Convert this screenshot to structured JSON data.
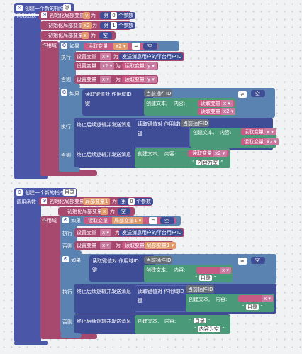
{
  "block1": {
    "header_label": "创建一个新的指令",
    "header_value": "渗",
    "call_label": "调用函数",
    "inits": [
      {
        "label": "初始化局部变量",
        "var": "y",
        "as": "为",
        "pre": "第",
        "index": "0",
        "post": "个参数"
      },
      {
        "label": "初始化局部变量",
        "var": "x2",
        "as": "为",
        "pre": "第",
        "index": "1",
        "post": "个参数"
      },
      {
        "label": "初始化局部变量",
        "var": "x",
        "as": "为",
        "value": "空"
      }
    ],
    "scope_label": "作用域",
    "if1": {
      "if_label": "如果",
      "cond_get": "读取变量",
      "cond_var": "x2",
      "cond_op": "=",
      "cond_value": "空",
      "then_label": "执行",
      "then_set": "设置变量",
      "then_var": "x",
      "then_as": "为",
      "then_value": "发送消息用户的平台用户ID",
      "then_set2": "设置变量",
      "then_var2": "x2",
      "then_as2": "为",
      "then_get2": "读取变量",
      "then_get_var2": "y",
      "else_label": "否则",
      "else_set": "设置变量",
      "else_var": "x",
      "else_as": "为",
      "else_get": "读取变量",
      "else_get_var": "y"
    },
    "if2": {
      "if_label": "如果",
      "kv_label": "读取键值对 作用域ID",
      "key_label": "键",
      "bot_id": "当前插件ID",
      "create_text": "创建文本,",
      "content_label": "内容:",
      "get_label": "读取变量",
      "get_x": "x",
      "get_x2": "x2",
      "op": "≠",
      "null_value": "空",
      "then_label": "执行",
      "stop_label": "终止后续逻辑并发送消息",
      "kv_label2": "读取键值对 作用域ID",
      "key_label2": "键",
      "bot_id2": "当前插件ID",
      "create_text2": "创建文本,",
      "content_label2": "内容:",
      "get_x_2": "x",
      "get_x2_2": "x2",
      "else_label": "否则",
      "else_stop": "终止后续逻辑并发送消息",
      "else_create": "创建文本,",
      "else_content": "内容:",
      "else_get_var": "x2",
      "else_string": "内容为空"
    }
  },
  "block2": {
    "header_label": "创建一个新的指令",
    "header_value": "目录",
    "call_label": "调用函数",
    "inits": [
      {
        "label": "初始化局部变量",
        "var": "局部变量1",
        "as": "为",
        "pre": "第",
        "index": "0",
        "post": "个参数"
      },
      {
        "label": "初始化局部变量",
        "var": "x",
        "as": "为",
        "value": "空"
      }
    ],
    "scope_label": "作用域",
    "if1": {
      "if_label": "如果",
      "cond_get": "读取变量",
      "cond_var": "局部变量1",
      "cond_op": "=",
      "cond_value": "空",
      "then_label": "执行",
      "then_set": "设置变量",
      "then_var": "x",
      "then_as": "为",
      "then_value": "发送消息用户的平台用户ID",
      "else_label": "否则",
      "else_set": "设置变量",
      "else_var": "x",
      "else_as": "为",
      "else_get": "读取变量",
      "else_get_var": "局部变量1"
    },
    "if2": {
      "if_label": "如果",
      "kv_label": "读取键值对 作用域ID",
      "key_label": "键",
      "bot_id": "当前插件ID",
      "create_text": "创建文本,",
      "content_label": "内容:",
      "get_x": "x",
      "catalog": "目录",
      "op": "≠",
      "null_value": "空",
      "then_label": "执行",
      "stop_label": "终止后续逻辑并发送消息",
      "kv_label2": "读取键值对 作用域ID",
      "key_label2": "键",
      "bot_id2": "当前插件ID",
      "create_text2": "创建文本,",
      "content_label2": "内容:",
      "get_x_2": "x",
      "catalog2": "目录",
      "else_label": "否则",
      "else_stop": "终止后续逻辑并发送消息",
      "else_create": "创建文本,",
      "else_content": "内容:",
      "else_string1": "目录",
      "else_string2": "内容为空"
    }
  },
  "colors": {
    "procedure": "#4a57a8",
    "variable": "#a7496f",
    "control": "#5b83b2",
    "text": "#4a9a7a",
    "canvas": "#f1f2f4"
  },
  "icons": {
    "gear": "gear-icon",
    "quote": "quote-icon",
    "dropdown": "dropdown-arrow-icon"
  }
}
